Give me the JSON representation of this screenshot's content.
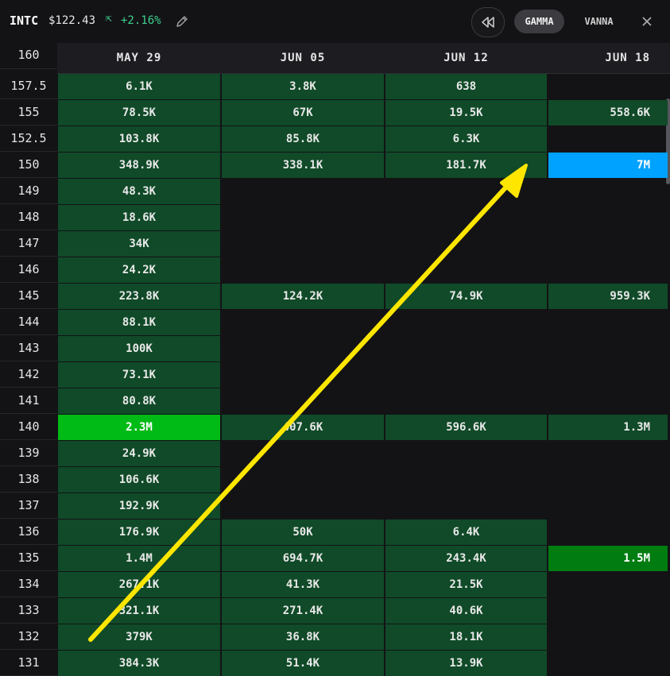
{
  "header": {
    "ticker": "INTC",
    "price": "$122.43",
    "change": "+2.16%",
    "tabs": {
      "gamma": "GAMMA",
      "vanna": "VANNA"
    },
    "active_tab": "GAMMA"
  },
  "icons": {
    "change": "arrow-up-left-icon",
    "edit": "pencil-icon",
    "rewind": "rewind-icon",
    "close": "close-icon"
  },
  "colors": {
    "background": "#131316",
    "cell": "#104a28",
    "cell_strong": "#00ba16",
    "cell_mid": "#007c10",
    "cell_blue": "#00a2ff",
    "positive": "#3ecf8e",
    "annotation_arrow": "#ffe600"
  },
  "grid": {
    "columns": [
      "MAY 29",
      "JUN 05",
      "JUN 12",
      "JUN 18"
    ],
    "header_strike": "160",
    "rows": [
      {
        "strike": "157.5",
        "cells": [
          "6.1K",
          "3.8K",
          "638",
          ""
        ]
      },
      {
        "strike": "155",
        "cells": [
          "78.5K",
          "67K",
          "19.5K",
          "558.6K"
        ]
      },
      {
        "strike": "152.5",
        "cells": [
          "103.8K",
          "85.8K",
          "6.3K",
          ""
        ]
      },
      {
        "strike": "150",
        "cells": [
          "348.9K",
          "338.1K",
          "181.7K",
          "7M"
        ]
      },
      {
        "strike": "149",
        "cells": [
          "48.3K",
          "",
          "",
          ""
        ]
      },
      {
        "strike": "148",
        "cells": [
          "18.6K",
          "",
          "",
          ""
        ]
      },
      {
        "strike": "147",
        "cells": [
          "34K",
          "",
          "",
          ""
        ]
      },
      {
        "strike": "146",
        "cells": [
          "24.2K",
          "",
          "",
          ""
        ]
      },
      {
        "strike": "145",
        "cells": [
          "223.8K",
          "124.2K",
          "74.9K",
          "959.3K"
        ]
      },
      {
        "strike": "144",
        "cells": [
          "88.1K",
          "",
          "",
          ""
        ]
      },
      {
        "strike": "143",
        "cells": [
          "100K",
          "",
          "",
          ""
        ]
      },
      {
        "strike": "142",
        "cells": [
          "73.1K",
          "",
          "",
          ""
        ]
      },
      {
        "strike": "141",
        "cells": [
          "80.8K",
          "",
          "",
          ""
        ]
      },
      {
        "strike": "140",
        "cells": [
          "2.3M",
          "407.6K",
          "596.6K",
          "1.3M"
        ]
      },
      {
        "strike": "139",
        "cells": [
          "24.9K",
          "",
          "",
          ""
        ]
      },
      {
        "strike": "138",
        "cells": [
          "106.6K",
          "",
          "",
          ""
        ]
      },
      {
        "strike": "137",
        "cells": [
          "192.9K",
          "",
          "",
          ""
        ]
      },
      {
        "strike": "136",
        "cells": [
          "176.9K",
          "50K",
          "6.4K",
          ""
        ]
      },
      {
        "strike": "135",
        "cells": [
          "1.4M",
          "694.7K",
          "243.4K",
          "1.5M"
        ]
      },
      {
        "strike": "134",
        "cells": [
          "267.1K",
          "41.3K",
          "21.5K",
          ""
        ]
      },
      {
        "strike": "133",
        "cells": [
          "321.1K",
          "271.4K",
          "40.6K",
          ""
        ]
      },
      {
        "strike": "132",
        "cells": [
          "379K",
          "36.8K",
          "18.1K",
          ""
        ]
      },
      {
        "strike": "131",
        "cells": [
          "384.3K",
          "51.4K",
          "13.9K",
          ""
        ]
      }
    ],
    "highlights": [
      {
        "strike": "140",
        "col": 0,
        "tone": "strong"
      },
      {
        "strike": "150",
        "col": 3,
        "tone": "blue"
      },
      {
        "strike": "135",
        "col": 3,
        "tone": "mid"
      }
    ]
  }
}
